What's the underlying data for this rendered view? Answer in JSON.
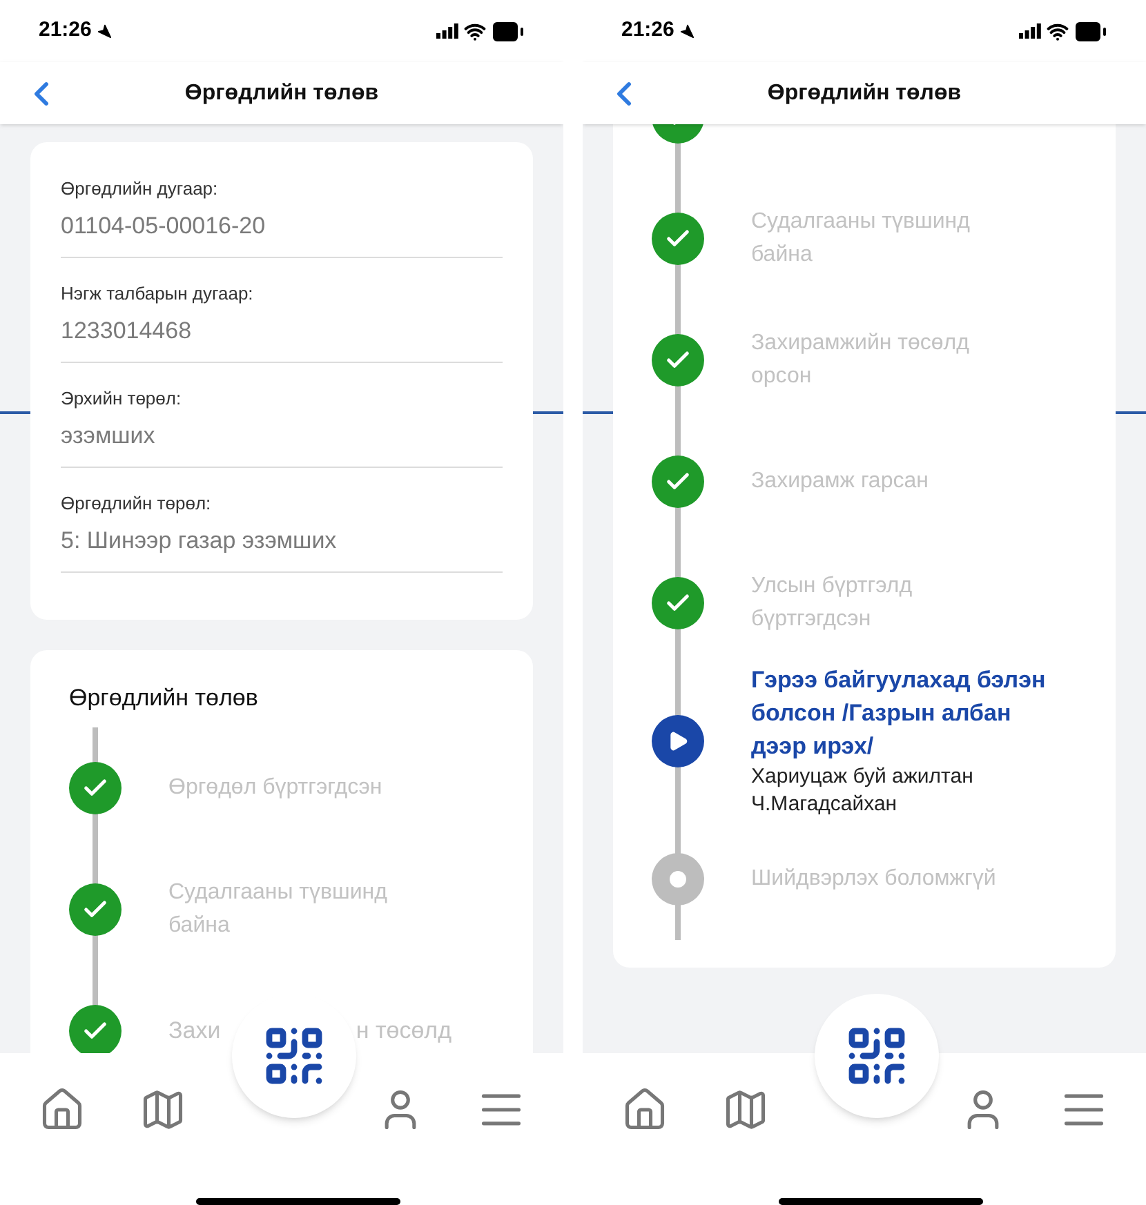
{
  "phones": [
    {
      "status_bar": {
        "time": "21:26"
      },
      "title": "Өргөдлийн төлөв",
      "scrolled": false,
      "info_card": {
        "fields": [
          {
            "label": "Өргөдлийн дугаар:",
            "value": "01104-05-00016-20"
          },
          {
            "label": "Нэгж талбарын дугаар:",
            "value": "1233014468"
          },
          {
            "label": "Эрхийн төрөл:",
            "value": "эзэмших"
          },
          {
            "label": "Өргөдлийн төрөл:",
            "value": "5: Шинээр газар эзэмших"
          }
        ]
      },
      "status_card": {
        "title": "Өргөдлийн төлөв",
        "steps": [
          {
            "kind": "done",
            "label": "Өргөдөл бүртгэгдсэн"
          },
          {
            "kind": "done",
            "label": "Судалгааны түвшинд байна"
          },
          {
            "kind": "done",
            "label_parts": [
              "Захи",
              "н төсөлд"
            ]
          }
        ]
      }
    },
    {
      "status_bar": {
        "time": "21:26"
      },
      "title": "Өргөдлийн төлөв",
      "scrolled": true,
      "status_card": {
        "steps": [
          {
            "kind": "done"
          },
          {
            "kind": "done",
            "label": "Судалгааны түвшинд байна"
          },
          {
            "kind": "done",
            "label": "Захирамжийн төсөлд орсон"
          },
          {
            "kind": "done",
            "label": "Захирамж гарсан"
          },
          {
            "kind": "done",
            "label": "Улсын бүртгэлд бүртгэгдсэн"
          },
          {
            "kind": "current",
            "label": "Гэрээ байгуулахад бэлэн болсон /Газрын албан дээр ирэх/",
            "note": "Хариуцаж буй ажилтан Ч.Магадсайхан"
          },
          {
            "kind": "pending",
            "label": "Шийдвэрлэх боломжгүй"
          }
        ]
      }
    }
  ]
}
